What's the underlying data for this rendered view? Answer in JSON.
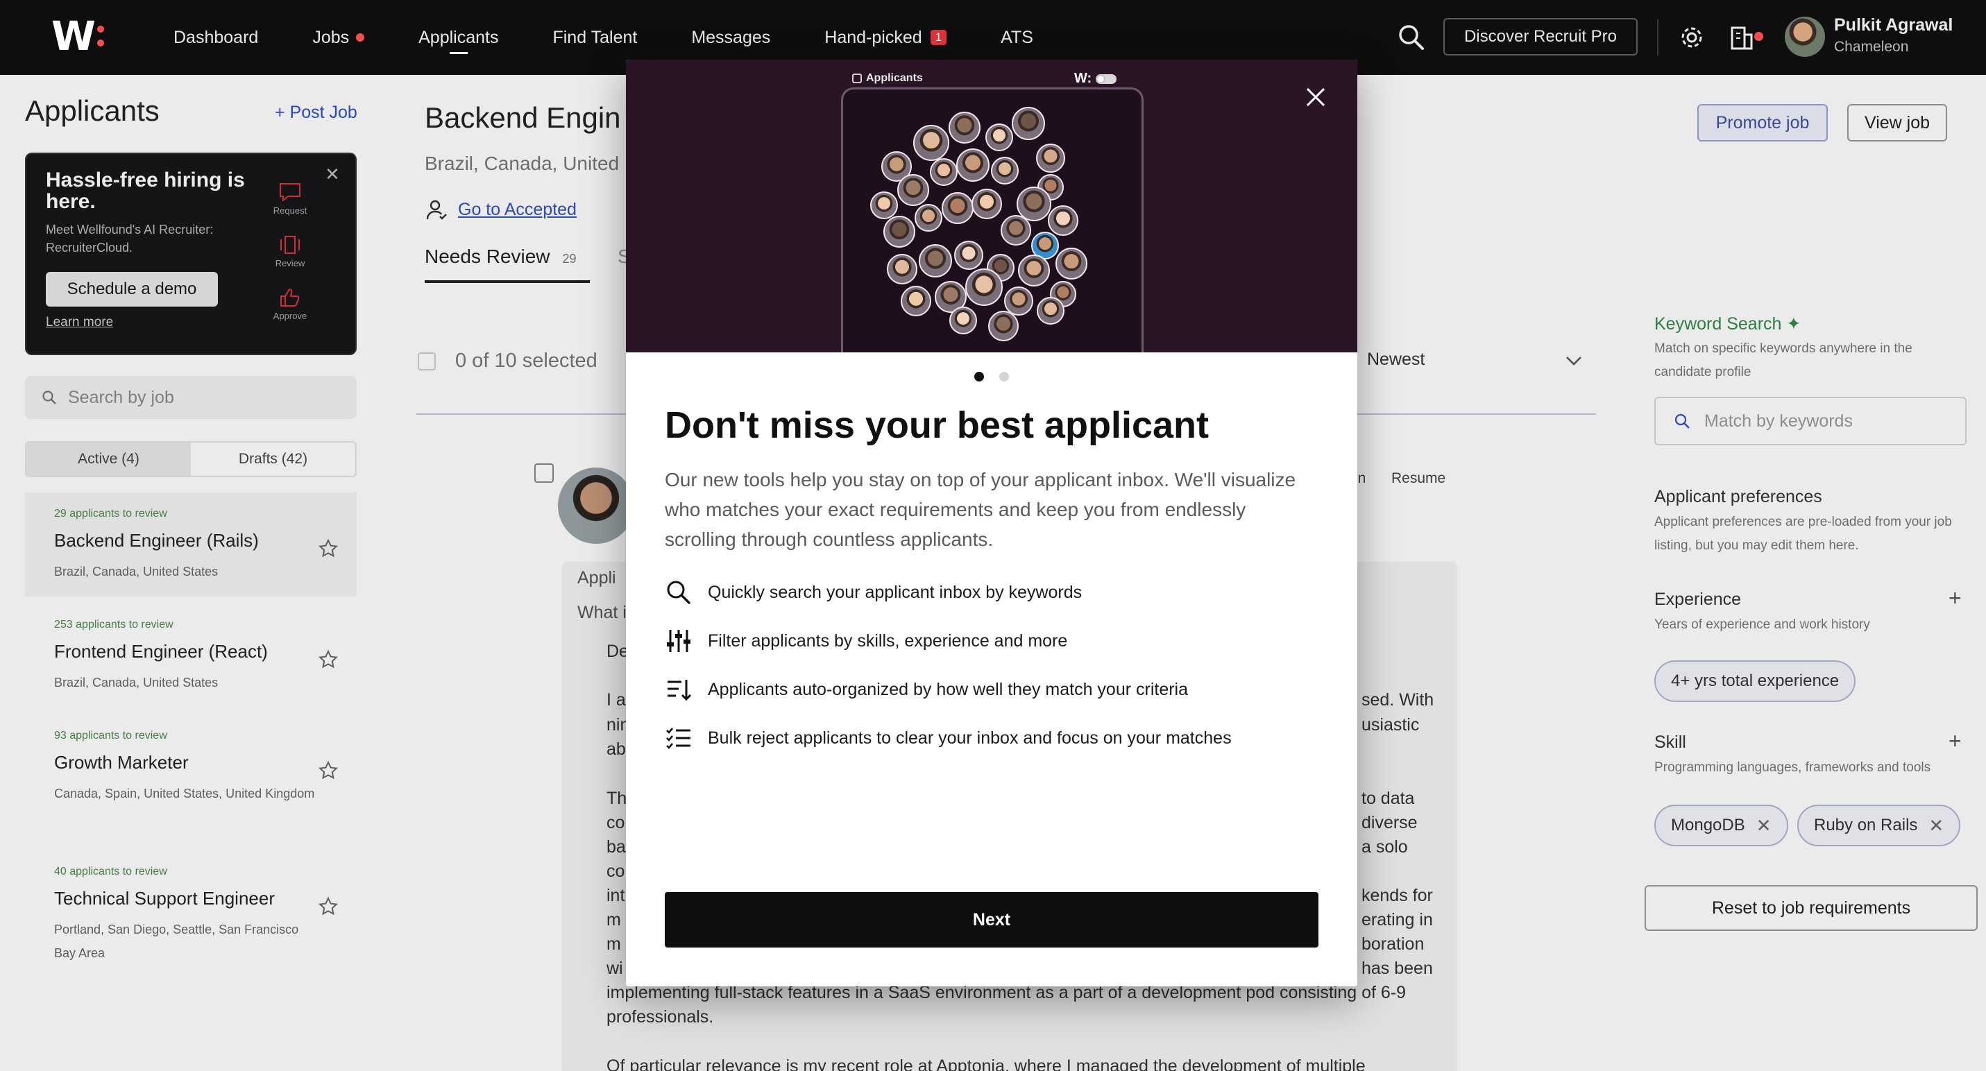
{
  "nav": {
    "items": [
      "Dashboard",
      "Jobs",
      "Applicants",
      "Find Talent",
      "Messages",
      "Hand-picked",
      "ATS"
    ],
    "handpicked_badge": "1",
    "discover_label": "Discover Recruit Pro",
    "user_name": "Pulkit Agrawal",
    "user_company": "Chameleon"
  },
  "sidebar": {
    "title": "Applicants",
    "post_job": "+ Post Job",
    "promo": {
      "title": "Hassle-free hiring is here.",
      "subtitle": "Meet Wellfound's AI Recruiter: RecruiterCloud.",
      "cta": "Schedule a demo",
      "learn_more": "Learn more",
      "steps": [
        "Request",
        "Review",
        "Approve"
      ]
    },
    "search_placeholder": "Search by job",
    "tabs": [
      "Active (4)",
      "Drafts (42)"
    ],
    "jobs": [
      {
        "count": "29 applicants to review",
        "name": "Backend Engineer (Rails)",
        "location": "Brazil, Canada, United States"
      },
      {
        "count": "253 applicants to review",
        "name": "Frontend Engineer (React)",
        "location": "Brazil, Canada, United States"
      },
      {
        "count": "93 applicants to review",
        "name": "Growth Marketer",
        "location": "Canada, Spain, United States, United Kingdom"
      },
      {
        "count": "40 applicants to review",
        "name": "Technical Support Engineer",
        "location": "Portland, San Diego, Seattle, San Francisco Bay Area"
      }
    ]
  },
  "main": {
    "title": "Backend Engin",
    "location": "Brazil, Canada, United",
    "go_accepted": "Go to Accepted",
    "needs_review": "Needs Review",
    "needs_review_count": "29",
    "tab2_partial": "S",
    "selected_text": "0 of 10 selected",
    "sort": "Newest",
    "in_link": "in",
    "resume_link": "Resume",
    "card_lines": [
      "Appli",
      "What i",
      "De",
      "I a",
      "nin",
      "ab",
      "Th",
      "co",
      "ba",
      "co",
      "int",
      "m",
      "m",
      "wi",
      "implementing full-stack features in a SaaS environment as a part of a development pod consisting of 6-9",
      "professionals.",
      "Of particular relevance is my recent role at Apptonia, where I managed the development of multiple"
    ],
    "card_right_fragments": [
      "sed. With",
      "usiastic",
      "to data",
      "diverse",
      "a solo",
      "kends for",
      "erating in",
      "boration",
      "has been"
    ]
  },
  "right": {
    "promote": "Promote job",
    "view_job": "View job",
    "keyword_title": "Keyword Search ✦",
    "keyword_sub": "Match on specific keywords anywhere in the candidate profile",
    "keyword_placeholder": "Match by keywords",
    "prefs_title": "Applicant preferences",
    "prefs_sub": "Applicant preferences are pre-loaded from your job listing, but you may edit them here.",
    "exp_title": "Experience",
    "exp_sub": "Years of experience and work history",
    "exp_chip": "4+ yrs total experience",
    "skill_title": "Skill",
    "skill_sub": "Programming languages, frameworks and tools",
    "skill_chips": [
      "MongoDB",
      "Ruby on Rails"
    ],
    "reset": "Reset to job requirements"
  },
  "modal": {
    "hero_label": "Applicants",
    "hero_logo": "W:",
    "page": 1,
    "pages": 2,
    "title": "Don't miss your best applicant",
    "description": "Our new tools help you stay on top of your applicant inbox. We'll visualize who matches your exact requirements and keep you from endlessly scrolling through countless applicants.",
    "features": [
      {
        "icon": "search-icon",
        "text": "Quickly search your applicant inbox by keywords"
      },
      {
        "icon": "sliders-icon",
        "text": "Filter applicants by skills, experience and more"
      },
      {
        "icon": "sort-icon",
        "text": "Applicants auto-organized by how well they match your criteria"
      },
      {
        "icon": "checklist-icon",
        "text": "Bulk reject applicants to clear your inbox and focus on your matches"
      }
    ],
    "next": "Next"
  },
  "colors": {
    "accent_blue": "#2e4fd6",
    "keyword_green": "#2f8a48",
    "hero_bg": "#2a1526",
    "nav_bg": "#0e0e0e"
  }
}
